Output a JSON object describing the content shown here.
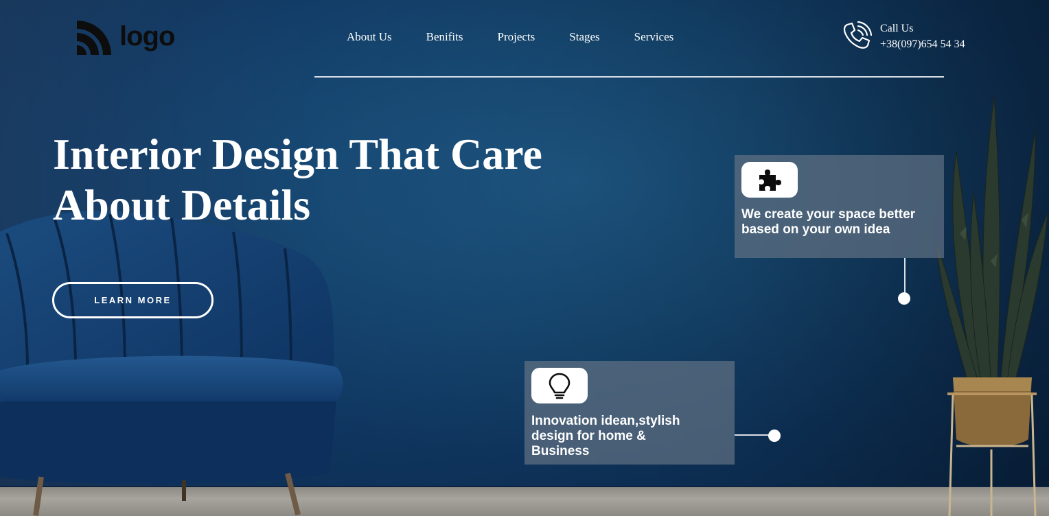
{
  "brand": {
    "logo_text": "logo"
  },
  "nav": {
    "items": [
      {
        "label": "About Us"
      },
      {
        "label": "Benifits"
      },
      {
        "label": "Projects"
      },
      {
        "label": "Stages"
      },
      {
        "label": "Services"
      }
    ]
  },
  "contact": {
    "label": "Call Us",
    "phone": "+38(097)654 54 34",
    "icon": "phone-icon"
  },
  "hero": {
    "title": "Interior Design That Care About Details",
    "cta_label": "LEARN MORE"
  },
  "features": [
    {
      "icon": "puzzle-icon",
      "text": "We create your space better based on your own idea"
    },
    {
      "icon": "lightbulb-icon",
      "text": "Innovation idean,stylish design for home & Business"
    }
  ],
  "colors": {
    "background": "#174a75",
    "card_background": "#607082",
    "text": "#ffffff",
    "logo": "#0d0d0d"
  }
}
